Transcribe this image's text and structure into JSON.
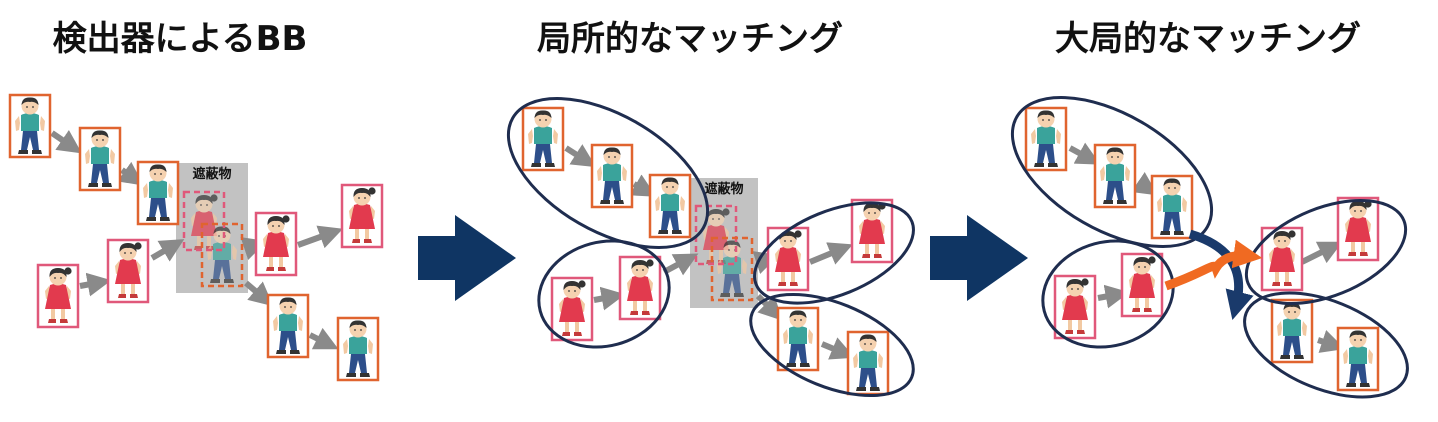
{
  "panels": [
    {
      "id": "detector",
      "title": "検出器によるBB",
      "occluder_label": "遮蔽物"
    },
    {
      "id": "local",
      "title": "局所的なマッチング",
      "occluder_label": "遮蔽物"
    },
    {
      "id": "global",
      "title": "大局的なマッチング"
    }
  ],
  "colors": {
    "boy_box": "#e0642f",
    "girl_box": "#e0587a",
    "arrow_gray": "#8a8a8a",
    "occluder": "#c2c2c2",
    "ellipse": "#1f2d4f",
    "big_arrow": "#0f3563",
    "link_orange": "#f06a22",
    "link_navy": "#1a3a6b"
  },
  "icons": {
    "boy": "boy-walking-icon",
    "girl": "girl-walking-icon",
    "transition": "right-triangle-arrow-icon"
  }
}
